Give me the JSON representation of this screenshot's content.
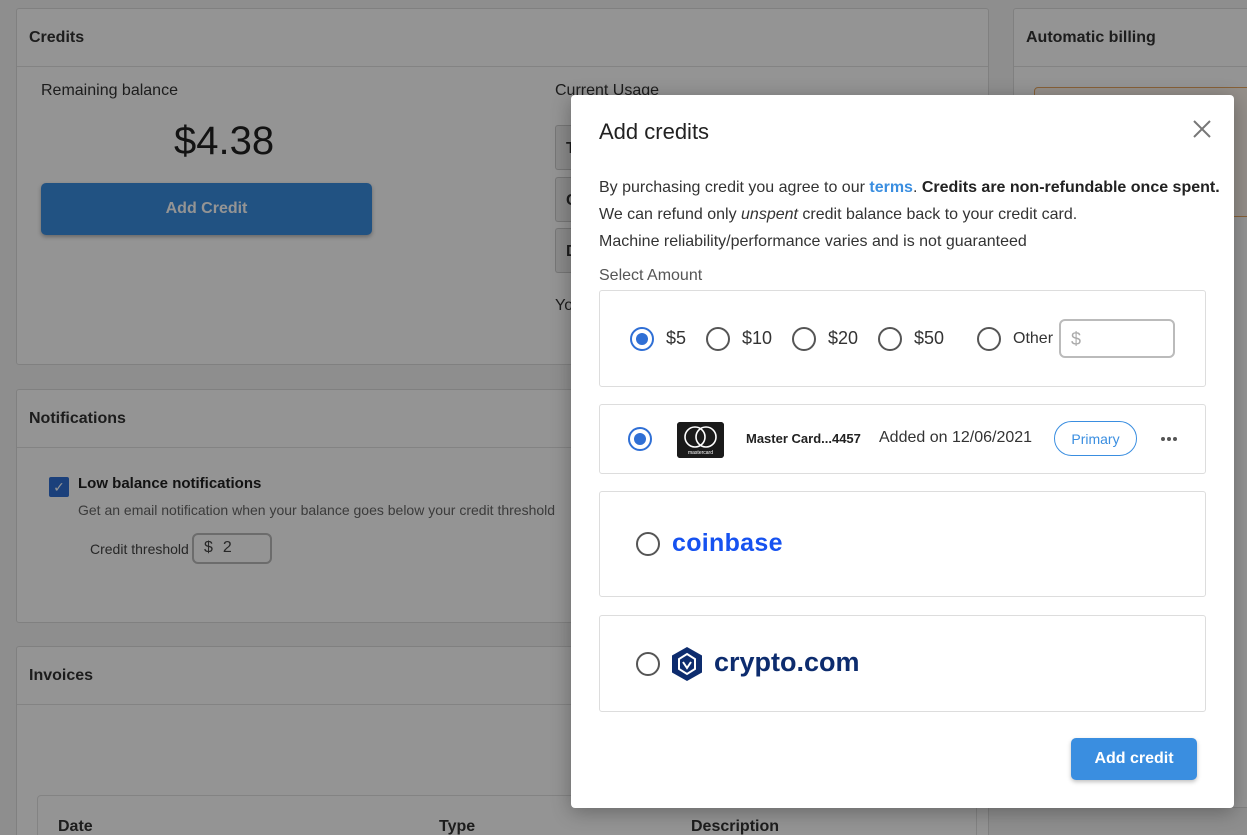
{
  "credits": {
    "title": "Credits",
    "remaining_label": "Remaining balance",
    "balance": "$4.38",
    "add_credit_button": "Add Credit",
    "current_usage_label": "Current Usage",
    "usage_rows": [
      "T",
      "C",
      "D"
    ],
    "usage_footer": "Yo"
  },
  "automatic_billing": {
    "title": "Automatic billing"
  },
  "notifications": {
    "title": "Notifications",
    "low_balance_title": "Low balance notifications",
    "low_balance_desc": "Get an email notification when your balance goes below your credit threshold",
    "threshold_label": "Credit threshold",
    "threshold_currency": "$",
    "threshold_value": "2"
  },
  "invoices": {
    "title": "Invoices",
    "columns": [
      "Date",
      "Type",
      "Description"
    ]
  },
  "modal": {
    "title": "Add credits",
    "terms_intro": "By purchasing credit you agree to our ",
    "terms_link": "terms",
    "terms_bold": "Credits are non-refundable once spent.",
    "refund_prefix": "We can refund only ",
    "refund_italic": "unspent",
    "refund_suffix": " credit balance back to your credit card.",
    "reliability": "Machine reliability/performance varies and is not guaranteed",
    "select_amount_label": "Select Amount",
    "amounts": [
      "$5",
      "$10",
      "$20",
      "$50"
    ],
    "selected_amount": "$5",
    "other_label": "Other",
    "other_placeholder": "$",
    "card": {
      "brand_logo_text": "mastercard",
      "name": "Master Card...4457",
      "added": "Added on 12/06/2021",
      "badge": "Primary"
    },
    "coinbase_label": "coinbase",
    "crypto_label": "crypto.com",
    "submit_button": "Add credit"
  },
  "colors": {
    "accent": "#3a8ee0",
    "checkbox": "#2f6fd5",
    "coinbase": "#1652f0",
    "crypto": "#0d2c6e"
  }
}
